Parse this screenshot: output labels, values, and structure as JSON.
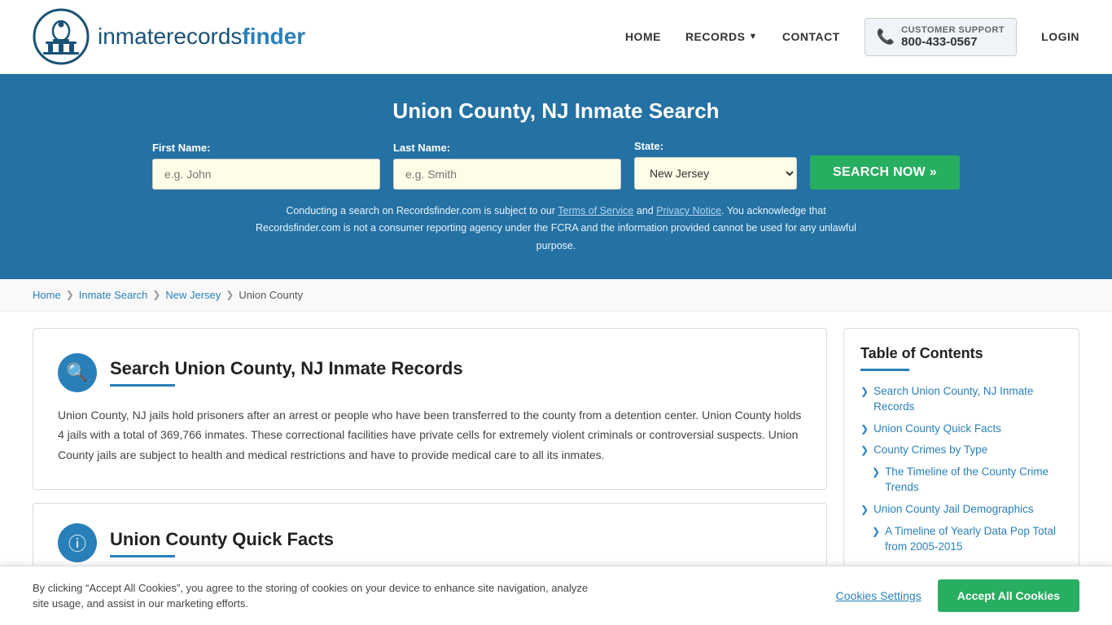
{
  "header": {
    "logo_text_main": "inmaterecords",
    "logo_text_bold": "finder",
    "nav": {
      "home": "HOME",
      "records": "RECORDS",
      "contact": "CONTACT",
      "support_label": "CUSTOMER SUPPORT",
      "support_number": "800-433-0567",
      "login": "LOGIN"
    }
  },
  "hero": {
    "title": "Union County, NJ Inmate Search",
    "first_name_label": "First Name:",
    "first_name_placeholder": "e.g. John",
    "last_name_label": "Last Name:",
    "last_name_placeholder": "e.g. Smith",
    "state_label": "State:",
    "state_value": "New Jersey",
    "search_button": "SEARCH NOW »",
    "disclaimer": "Conducting a search on Recordsfinder.com is subject to our Terms of Service and Privacy Notice. You acknowledge that Recordsfinder.com is not a consumer reporting agency under the FCRA and the information provided cannot be used for any unlawful purpose.",
    "terms_link": "Terms of Service",
    "privacy_link": "Privacy Notice"
  },
  "breadcrumb": {
    "home": "Home",
    "inmate_search": "Inmate Search",
    "state": "New Jersey",
    "county": "Union County"
  },
  "main_card": {
    "title": "Search Union County, NJ Inmate Records",
    "body": "Union County, NJ jails hold prisoners after an arrest or people who have been transferred to the county from a detention center. Union County holds 4 jails with a total of 369,766 inmates. These correctional facilities have private cells for extremely violent criminals or controversial suspects. Union County jails are subject to health and medical restrictions and have to provide medical care to all its inmates."
  },
  "second_card": {
    "title": "Union County Quick Facts"
  },
  "toc": {
    "title": "Table of Contents",
    "items": [
      {
        "label": "Search Union County, NJ Inmate Records",
        "indent": false
      },
      {
        "label": "Union County Quick Facts",
        "indent": false
      },
      {
        "label": "County Crimes by Type",
        "indent": false
      },
      {
        "label": "The Timeline of the County Crime Trends",
        "indent": true
      },
      {
        "label": "Union County Jail Demographics",
        "indent": false
      },
      {
        "label": "A Timeline of Yearly Data Pop Total from 2005-2015",
        "indent": true
      }
    ]
  },
  "cookie_banner": {
    "text": "By clicking “Accept All Cookies”, you agree to the storing of cookies on your device to enhance site navigation, analyze site usage, and assist in our marketing efforts.",
    "settings_label": "Cookies Settings",
    "accept_label": "Accept All Cookies"
  }
}
